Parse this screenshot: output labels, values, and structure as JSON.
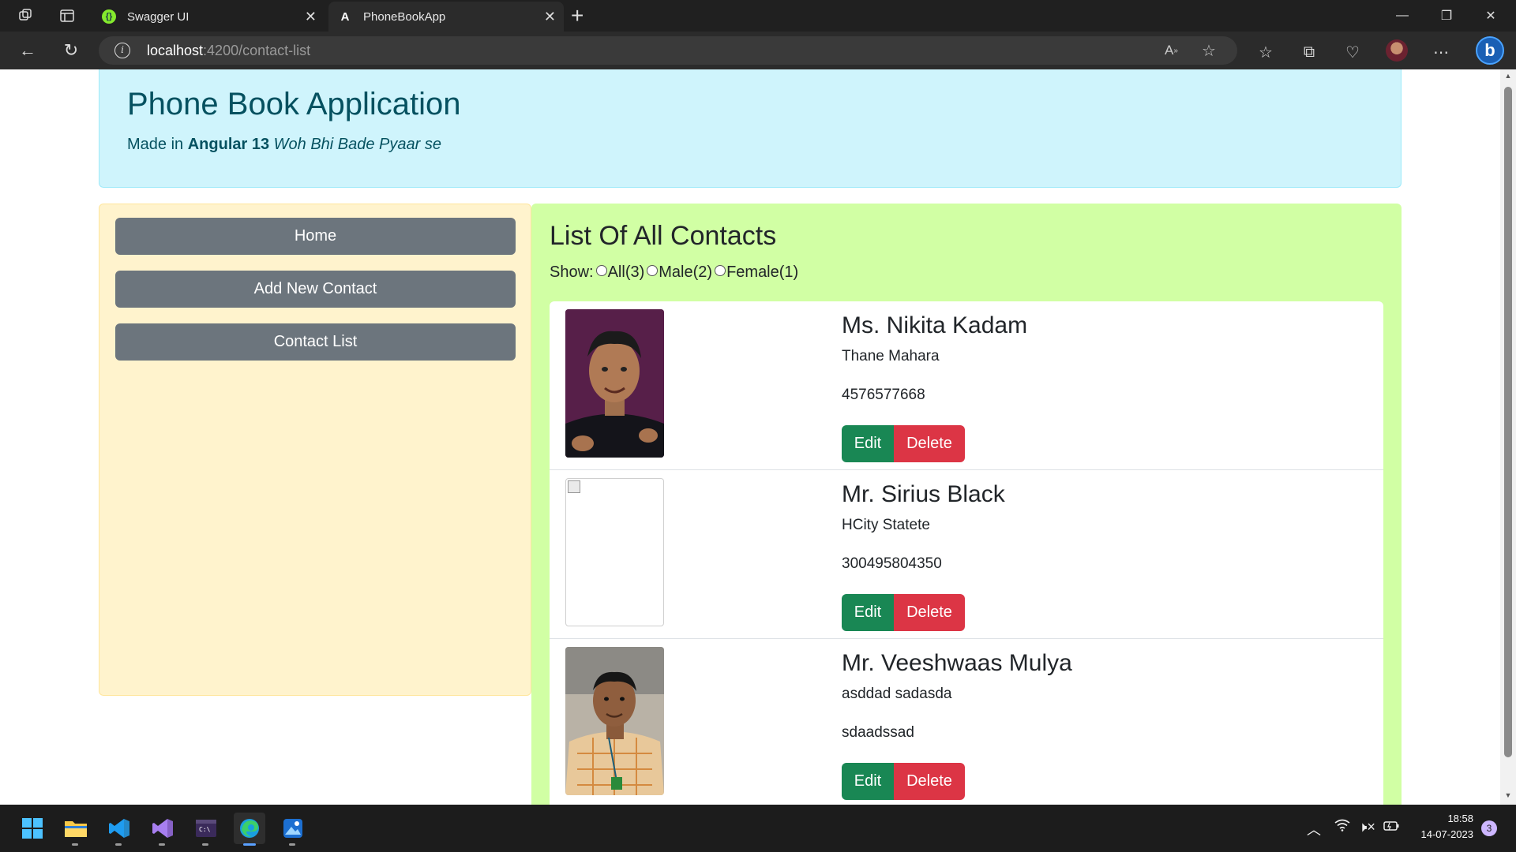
{
  "browser": {
    "tabs": [
      {
        "label": "Swagger UI",
        "active": false
      },
      {
        "label": "PhoneBookApp",
        "active": true
      }
    ],
    "url_host": "localhost",
    "url_path": ":4200/contact-list"
  },
  "header": {
    "title": "Phone Book Application",
    "made_in": "Made in",
    "framework": "Angular 13",
    "tagline": "Woh Bhi Bade Pyaar se"
  },
  "sidebar": {
    "items": [
      {
        "label": "Home"
      },
      {
        "label": "Add New Contact"
      },
      {
        "label": "Contact List"
      }
    ]
  },
  "main": {
    "title": "List Of All Contacts",
    "show_label": "Show:",
    "filters": [
      {
        "label": "All(3)"
      },
      {
        "label": "Male(2)"
      },
      {
        "label": "Female(1)"
      }
    ],
    "edit_label": "Edit",
    "delete_label": "Delete",
    "contacts": [
      {
        "name": "Ms. Nikita Kadam",
        "address": "Thane Mahara",
        "phone": "4576577668",
        "photo": "boy-photo"
      },
      {
        "name": "Mr. Sirius Black",
        "address": "HCity Statete",
        "phone": "300495804350",
        "photo": "broken-image"
      },
      {
        "name": "Mr. Veeshwaas Mulya",
        "address": "asddad sadasda",
        "phone": "sdaadssad",
        "photo": "man-photo"
      }
    ]
  },
  "taskbar": {
    "time": "18:58",
    "date": "14-07-2023",
    "notifications": "3"
  },
  "colors": {
    "header_bg": "#cff4fc",
    "sidebar_bg": "#fff3cd",
    "main_bg": "#d1ffa4",
    "button_gray": "#6c757d",
    "edit_green": "#198754",
    "delete_red": "#dc3545"
  }
}
